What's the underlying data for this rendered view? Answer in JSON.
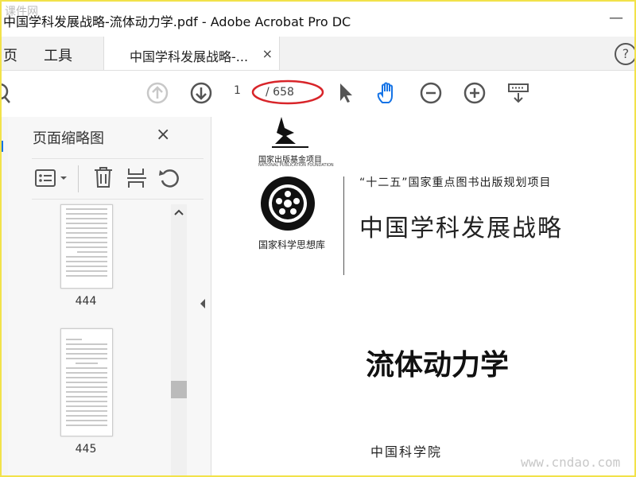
{
  "window": {
    "title": "中国学科发展战略-流体动力学.pdf - Adobe Acrobat Pro DC",
    "watermark_top": "课件网",
    "minimize_label": "—"
  },
  "menubar": {
    "items": [
      "页",
      "工具"
    ],
    "doc_tab_label": "中国学科发展战略-...",
    "doc_tab_close": "×",
    "help": "?"
  },
  "toolbar": {
    "current_page": "1",
    "total_pages": "/ 658",
    "icons": [
      "search-icon",
      "prev-page-icon",
      "next-page-icon",
      "select-arrow-icon",
      "hand-icon",
      "zoom-out-icon",
      "zoom-in-icon",
      "keyboard-icon"
    ],
    "highlight_color": "#d8252a",
    "active_color": "#1473e6"
  },
  "panel": {
    "title": "页面缩略图",
    "close": "×",
    "thumbnails": [
      {
        "label": "444"
      },
      {
        "label": "445"
      }
    ]
  },
  "document": {
    "publisher": "国家出版基金项目",
    "publisher_en": "NATIONAL PUBLICATION FOUNDATION",
    "series_library": "国家科学思想库",
    "project": "“十二五”国家重点图书出版规划项目",
    "series_title": "中国学科发展战略",
    "book_title": "流体动力学",
    "author": "中国科学院"
  },
  "footer": {
    "site_watermark": "www.cndao.com"
  }
}
